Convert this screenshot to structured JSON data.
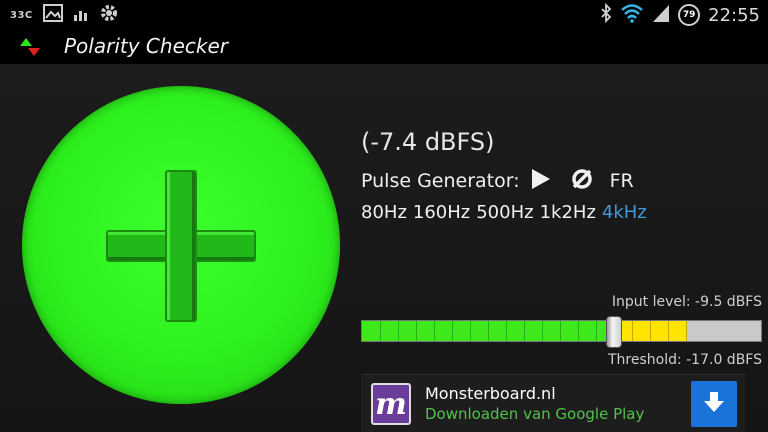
{
  "status_bar": {
    "temperature": "33C",
    "clock": "22:55",
    "battery_level": "79",
    "icons": [
      "image-icon",
      "bars-icon",
      "gear-icon",
      "bluetooth-icon",
      "wifi-icon",
      "signal-icon"
    ]
  },
  "app": {
    "title": "Polarity Checker",
    "polarity_symbol": "plus"
  },
  "main": {
    "level_readout": "(-7.4 dBFS)",
    "pulse_generator_label": "Pulse Generator:",
    "fr_label": "FR",
    "frequencies": [
      {
        "label": "80Hz",
        "active": false
      },
      {
        "label": "160Hz",
        "active": false
      },
      {
        "label": "500Hz",
        "active": false
      },
      {
        "label": "1k2Hz",
        "active": false
      },
      {
        "label": "4kHz",
        "active": true
      }
    ],
    "input_level_label": "Input level: -9.5 dBFS",
    "threshold_label": "Threshold: -17.0 dBFS",
    "meter": {
      "green_fraction": 0.635,
      "yellow_fraction": 0.18,
      "threshold_fraction": 0.635
    }
  },
  "ad": {
    "logo_letter": "m",
    "title": "Monsterboard.nl",
    "subtitle": "Downloaden van Google Play"
  },
  "colors": {
    "accent": "#3d9ad6",
    "polarity_green": "#2ef01e",
    "meter_green": "#3ee81c",
    "meter_yellow": "#ffe400",
    "ad_subtitle": "#52c24b",
    "download_blue": "#1a73d9"
  }
}
